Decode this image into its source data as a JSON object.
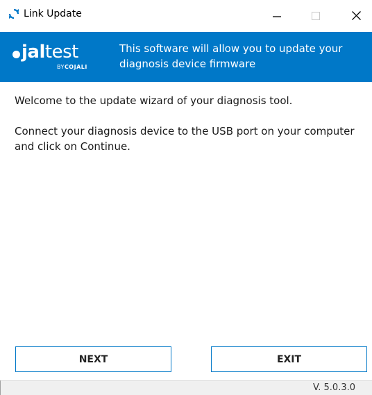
{
  "window": {
    "title": "Link Update",
    "controls": {
      "minimize_icon": "minimize-icon",
      "maximize_icon": "maximize-icon",
      "close_icon": "close-icon"
    }
  },
  "banner": {
    "logo": {
      "main_bold": "jal",
      "main_light": "test",
      "sub_prefix": "BY",
      "sub_brand": "COJALI"
    },
    "text": "This software will allow you to update your diagnosis device firmware",
    "background_color": "#0078c8"
  },
  "content": {
    "welcome": "Welcome to the update wizard of your diagnosis tool.",
    "instruction": "Connect your diagnosis device to the USB port on your computer and click on Continue."
  },
  "buttons": {
    "next_label": "NEXT",
    "exit_label": "EXIT",
    "border_color": "#0078c8"
  },
  "status": {
    "version": "V. 5.0.3.0"
  }
}
